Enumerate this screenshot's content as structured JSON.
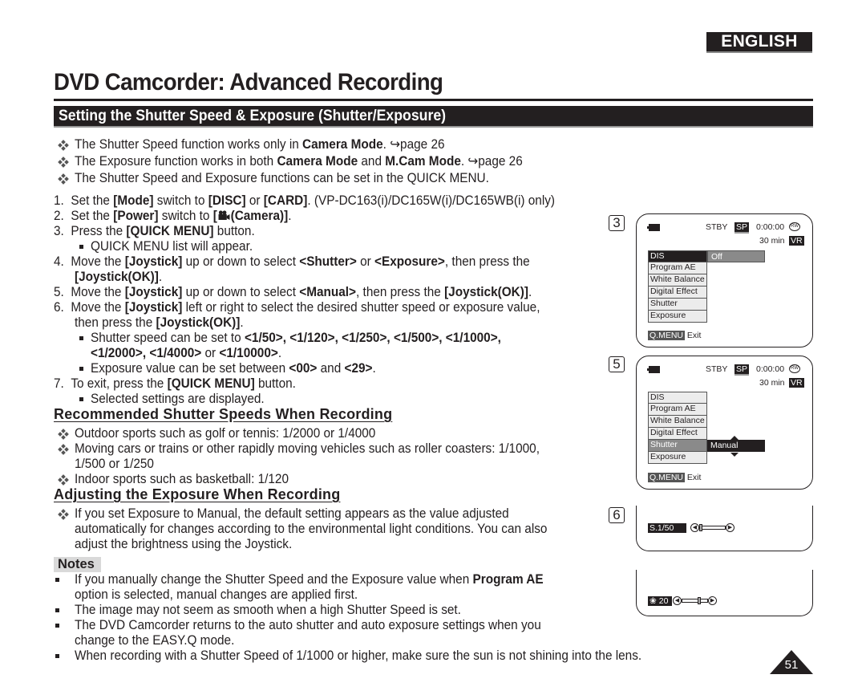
{
  "header": {
    "language": "ENGLISH",
    "page_title": "DVD Camcorder: Advanced Recording",
    "section_title": "Setting the Shutter Speed & Exposure (Shutter/Exposure)"
  },
  "intro_bullets": [
    {
      "pre": "The Shutter Speed function works only in ",
      "b1": "Camera Mode",
      "mid": ". ",
      "ref": "↪page 26"
    },
    {
      "pre": "The Exposure function works in both ",
      "b1": "Camera Mode",
      "mid": " and ",
      "b2": "M.Cam Mode",
      "post": ". ",
      "ref": "↪page 26"
    },
    {
      "pre": "The Shutter Speed and Exposure functions can be set in the QUICK MENU."
    }
  ],
  "steps": {
    "s1": {
      "num": "1.",
      "a": "Set the ",
      "b": "[Mode]",
      "c": " switch to ",
      "d": "[DISC]",
      "e": " or ",
      "f": "[CARD]",
      "g": ". (VP-DC163(i)/DC165W(i)/DC165WB(i) only)"
    },
    "s2": {
      "num": "2.",
      "a": "Set the ",
      "b": "[Power]",
      "c": " switch to ",
      "d": "[",
      "icon": "camera-icon",
      "e": "(Camera)]",
      "f": "."
    },
    "s3": {
      "num": "3.",
      "a": "Press the ",
      "b": "[QUICK MENU]",
      "c": " button.",
      "sub": "QUICK MENU list will appear."
    },
    "s4": {
      "num": "4.",
      "a": "Move the ",
      "b": "[Joystick]",
      "c": " up or down to select ",
      "d": "<Shutter>",
      "e": " or ",
      "f": "<Exposure>",
      "g": ", then press the",
      "h": "[Joystick(OK)]",
      "i": "."
    },
    "s5": {
      "num": "5.",
      "a": "Move the ",
      "b": "[Joystick]",
      "c": " up or down to select ",
      "d": "<Manual>",
      "e": ", then press the ",
      "f": "[Joystick(OK)]",
      "g": "."
    },
    "s6": {
      "num": "6.",
      "a": "Move the ",
      "b": "[Joystick]",
      "c": " left or right to select the desired shutter speed or exposure value,",
      "d": "then press the ",
      "e": "[Joystick(OK)]",
      "f": ".",
      "sub1_a": "Shutter speed can be set to ",
      "sub1_values_line1": "<1/50>, <1/120>, <1/250>, <1/500>, <1/1000>,",
      "sub1_values_line2a": "<1/2000>, <1/4000>",
      "sub1_or": " or ",
      "sub1_values_line2b": "<1/10000>",
      "sub1_end": ".",
      "sub2_a": "Exposure value can be set between ",
      "sub2_b": "<00>",
      "sub2_c": " and ",
      "sub2_d": "<29>",
      "sub2_e": "."
    },
    "s7": {
      "num": "7.",
      "a": "To exit, press the ",
      "b": "[QUICK MENU]",
      "c": " button.",
      "sub": "Selected settings are displayed."
    }
  },
  "recommended": {
    "heading": "Recommended Shutter Speeds When Recording",
    "items": [
      "Outdoor sports such as golf or tennis: 1/2000 or 1/4000",
      "Moving cars or trains or other rapidly moving vehicles such as roller coasters: 1/1000,",
      "1/500 or 1/250",
      "Indoor sports such as basketball: 1/120"
    ]
  },
  "adjusting": {
    "heading": "Adjusting the Exposure When Recording",
    "lines": [
      "If you set Exposure to Manual, the default setting appears as the value adjusted",
      "automatically for changes according to the environmental light conditions. You can also",
      "adjust the brightness using the Joystick."
    ]
  },
  "notes": {
    "label": "Notes",
    "n1a": "If you manually change the Shutter Speed and the Exposure value when ",
    "n1b": "Program AE",
    "n1c": "option is selected, manual changes are applied first.",
    "n2": "The image may not seem as smooth when a high Shutter Speed is set.",
    "n3a": "The DVD Camcorder returns to the auto shutter and auto exposure settings when you",
    "n3b": "change to the EASY.Q mode.",
    "n4": "When recording with a Shutter Speed of 1/1000 or higher, make sure the sun is not shining into the lens."
  },
  "lcd_screens": {
    "screen3": {
      "step": "3",
      "status": "STBY",
      "quality": "SP",
      "timecode": "0:00:00",
      "disc": "RW",
      "remaining": "30 min",
      "format": "VR",
      "menu": [
        "DIS",
        "Program AE",
        "White Balance",
        "Digital Effect",
        "Shutter",
        "Exposure"
      ],
      "selected_index": 0,
      "submenu_value": "Off",
      "exit_key": "Q.MENU",
      "exit_label": "Exit"
    },
    "screen5": {
      "step": "5",
      "status": "STBY",
      "quality": "SP",
      "timecode": "0:00:00",
      "disc": "RW",
      "remaining": "30 min",
      "format": "VR",
      "menu": [
        "DIS",
        "Program AE",
        "White Balance",
        "Digital Effect",
        "Shutter",
        "Exposure"
      ],
      "selected_index": 4,
      "submenu_value": "Manual",
      "exit_key": "Q.MENU",
      "exit_label": "Exit"
    },
    "screen6a": {
      "step": "6",
      "label": "S.1/50",
      "slider_position": 0.0
    },
    "screen6b": {
      "icon": "aperture-icon",
      "label": "20",
      "slider_position": 0.69
    }
  },
  "footer": {
    "page_number": "51"
  }
}
